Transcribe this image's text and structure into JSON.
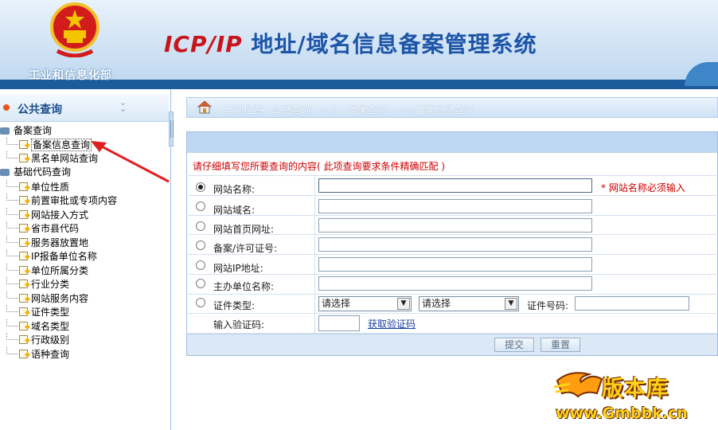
{
  "header": {
    "ministry": "工业和信息化部",
    "title_latin": "ICP/IP ",
    "title_cn": "地址/域名信息备案管理系统"
  },
  "sidebar": {
    "title": "公共查询",
    "groups": [
      {
        "label": "备案查询",
        "items": [
          "备案信息查询",
          "黑名单网站查询"
        ]
      },
      {
        "label": "基础代码查询",
        "items": [
          "单位性质",
          "前置审批或专项内容",
          "网站接入方式",
          "省市县代码",
          "服务器放置地",
          "IP报备单位名称",
          "单位所属分类",
          "行业分类",
          "网站服务内容",
          "证件类型",
          "域名类型",
          "行政级别",
          "语种查询"
        ]
      }
    ]
  },
  "breadcrumb": {
    "prefix": "当前位置：公共查询",
    "sep1": "－＞",
    "mid": "备案查询",
    "sep2": "－＞备案信息查询"
  },
  "form": {
    "hint": "请仔细填写您所要查询的内容( 此项查询要求条件精确匹配 )",
    "fields": {
      "site_name": "网站名称:",
      "domain": "网站域名:",
      "homepage": "网站首页网址:",
      "license": "备案/许可证号:",
      "ip": "网站IP地址:",
      "sponsor": "主办单位名称:",
      "cert_type": "证件类型:",
      "captcha": "输入验证码:"
    },
    "required_note": "* 网站名称必须输入",
    "select1": "请选择",
    "select2": "请选择",
    "cert_no_label": "证件号码:",
    "captcha_link": "获取验证码",
    "submit": "提交",
    "reset": "重置"
  },
  "watermark": {
    "name": "版本库",
    "url": "www.Gmbbk.cn"
  },
  "colors": {
    "accent": "#1c5c9c",
    "hint_red": "#cc0000",
    "title_red": "#c8151b",
    "title_blue": "#1d55a8"
  }
}
